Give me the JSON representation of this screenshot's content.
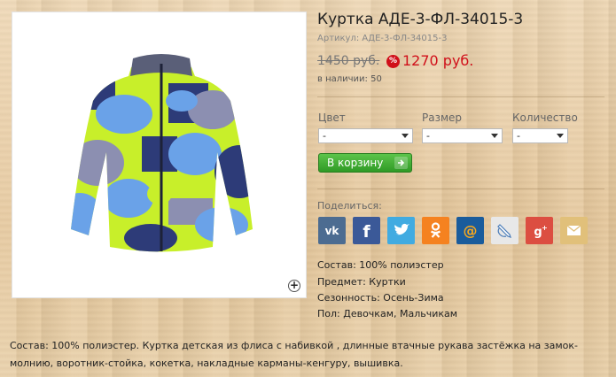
{
  "product": {
    "title": "Куртка АДЕ-3-ФЛ-34015-3",
    "sku": "Артикул: АДЕ-3-ФЛ-34015-3",
    "old_price": "1450 руб.",
    "sale_badge": "%",
    "new_price": "1270 руб.",
    "stock": "в наличии: 50"
  },
  "options": {
    "color": {
      "label": "Цвет",
      "value": "-"
    },
    "size": {
      "label": "Размер",
      "value": "-"
    },
    "quantity": {
      "label": "Количество",
      "value": "-"
    }
  },
  "cart_button": {
    "label": "В корзину"
  },
  "share": {
    "label": "Поделиться:",
    "services": [
      {
        "icon": "vk-icon",
        "label": "vk",
        "color": "#4c6c91"
      },
      {
        "icon": "facebook-icon",
        "label": "f",
        "color": "#3b5998"
      },
      {
        "icon": "twitter-icon",
        "label": "twitter",
        "color": "#41abe1"
      },
      {
        "icon": "odnoklassniki-icon",
        "label": "ok",
        "color": "#f58220"
      },
      {
        "icon": "mailru-icon",
        "label": "@",
        "color": "#168de2"
      },
      {
        "icon": "livejournal-icon",
        "label": "lj",
        "color": "#e8e8e8"
      },
      {
        "icon": "googleplus-icon",
        "label": "g+",
        "color": "#dc4e41"
      },
      {
        "icon": "email-icon",
        "label": "email",
        "color": "#e1c07a"
      }
    ]
  },
  "specs": {
    "composition": "Состав: 100% полиэстер",
    "subject": "Предмет: Куртки",
    "season": "Сезонность: Осень-Зима",
    "gender": "Пол: Девочкам, Мальчикам"
  },
  "description": "Состав: 100% полиэстер. Куртка детская из флиса с набивкой , длинные втачные рукава застёжка на замок-молнию, воротник-стойка, кокетка, накладные карманы-кенгуру, вышивка.",
  "zoom_icon": "+"
}
